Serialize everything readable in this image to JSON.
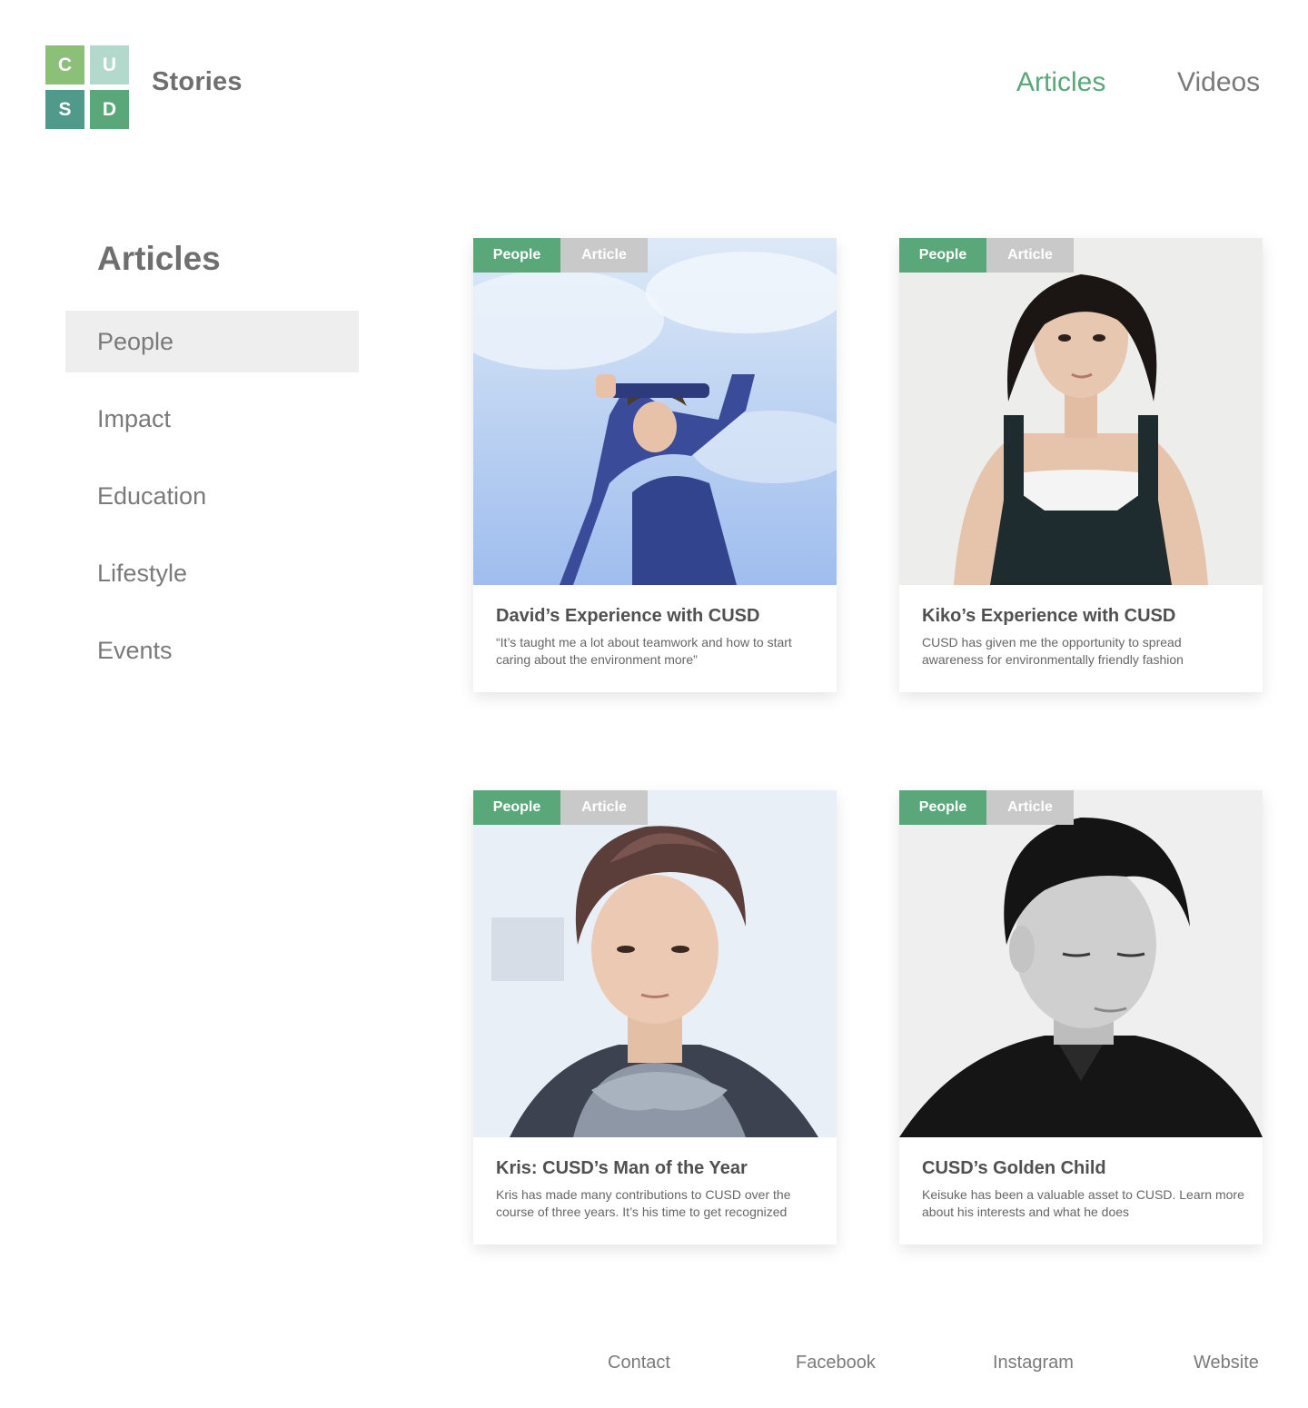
{
  "brand": {
    "logo_letters": [
      "C",
      "U",
      "S",
      "D"
    ],
    "logo_colors": [
      "#8cc07a",
      "#b3d8cc",
      "#4f9a8a",
      "#5aa77a"
    ],
    "site_name": "Stories"
  },
  "top_nav": {
    "items": [
      {
        "label": "Articles",
        "active": true
      },
      {
        "label": "Videos",
        "active": false
      }
    ]
  },
  "sidebar": {
    "heading": "Articles",
    "items": [
      {
        "label": "People",
        "active": true
      },
      {
        "label": "Impact",
        "active": false
      },
      {
        "label": "Education",
        "active": false
      },
      {
        "label": "Lifestyle",
        "active": false
      },
      {
        "label": "Events",
        "active": false
      }
    ]
  },
  "cards": [
    {
      "tag_category": "People",
      "tag_type": "Article",
      "title": "David’s Experience with CUSD",
      "description": "“It’s taught me a lot about teamwork and how to start caring about the environment more”"
    },
    {
      "tag_category": "People",
      "tag_type": "Article",
      "title": "Kiko’s Experience with CUSD",
      "description": "CUSD has given me the opportunity to spread awareness for environmentally friendly fashion"
    },
    {
      "tag_category": "People",
      "tag_type": "Article",
      "title": "Kris: CUSD’s Man of the Year",
      "description": "Kris has made many contributions to CUSD over the course of three years. It’s his time to get recognized"
    },
    {
      "tag_category": "People",
      "tag_type": "Article",
      "title": "CUSD’s Golden Child",
      "description": "Keisuke has been a valuable asset to CUSD. Learn more about his interests and what he does"
    }
  ],
  "footer": {
    "links": [
      "Contact",
      "Facebook",
      "Instagram",
      "Website"
    ]
  },
  "colors": {
    "accent_green": "#5aa77a",
    "tag_gray": "#c9c9c9",
    "text_gray": "#707070",
    "active_bg": "#eeeeee"
  }
}
